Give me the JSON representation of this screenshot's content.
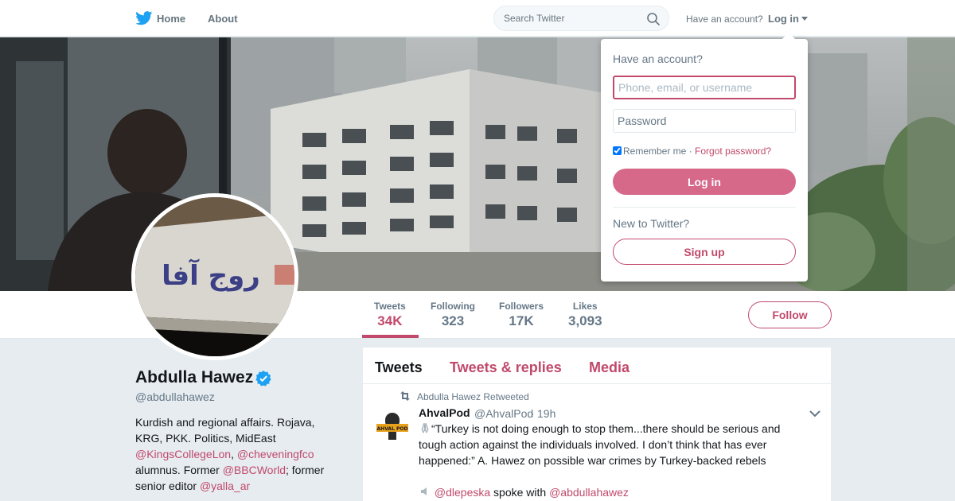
{
  "nav": {
    "home": "Home",
    "about": "About",
    "search_placeholder": "Search Twitter",
    "have_account": "Have an account?",
    "login": "Log in"
  },
  "icons": {
    "logo": "twitter-bird-icon",
    "search": "search-icon",
    "verified": "verified-badge-icon",
    "retweet": "retweet-icon",
    "chevron": "chevron-down-icon",
    "emoji_hands": "folded-hands-emoji",
    "emoji_speaker": "speaker-emoji"
  },
  "colors": {
    "accent": "#c1496b",
    "login_button": "#d6688a",
    "twitter_blue": "#1da1f2"
  },
  "stats": [
    {
      "label": "Tweets",
      "value": "34K"
    },
    {
      "label": "Following",
      "value": "323"
    },
    {
      "label": "Followers",
      "value": "17K"
    },
    {
      "label": "Likes",
      "value": "3,093"
    }
  ],
  "follow_label": "Follow",
  "profile": {
    "name": "Abdulla Hawez",
    "handle": "@abdullahawez",
    "bio_1": "Kurdish and regional affairs. Rojava, KRG, PKK. Politics, MidEast",
    "bio_link_1": "@KingsCollegeLon",
    "bio_sep": ",",
    "bio_link_2": "@cheveningfco",
    "bio_2": "alumnus. Former",
    "bio_link_3": "@BBCWorld",
    "bio_3": "; former senior editor",
    "bio_link_4": "@yalla_ar",
    "avatar_wall_text": "روج آفا"
  },
  "timeline": {
    "tabs": [
      "Tweets",
      "Tweets & replies",
      "Media"
    ],
    "retweeted_by": "Abdulla Hawez Retweeted",
    "tweet": {
      "name": "AhvalPod",
      "handle": "@AhvalPod",
      "dot": "·",
      "time": "19h",
      "text": "“Turkey is not doing enough to stop them...there should be serious and tough action against the individuals involved. I don’t think that has ever happened:” A. Hawez on possible war crimes by Turkey-backed rebels",
      "mention_1": "@dlepeska",
      "spoke_with": "spoke with",
      "mention_2": "@abdullahawez",
      "avatar_text": "AHVAL POD"
    }
  },
  "login_dropdown": {
    "title": "Have an account?",
    "username_placeholder": "Phone, email, or username",
    "password_placeholder": "Password",
    "remember": "Remember me",
    "sep": "·",
    "forgot": "Forgot password?",
    "login_button": "Log in",
    "new_to_twitter": "New to Twitter?",
    "signup_button": "Sign up"
  }
}
